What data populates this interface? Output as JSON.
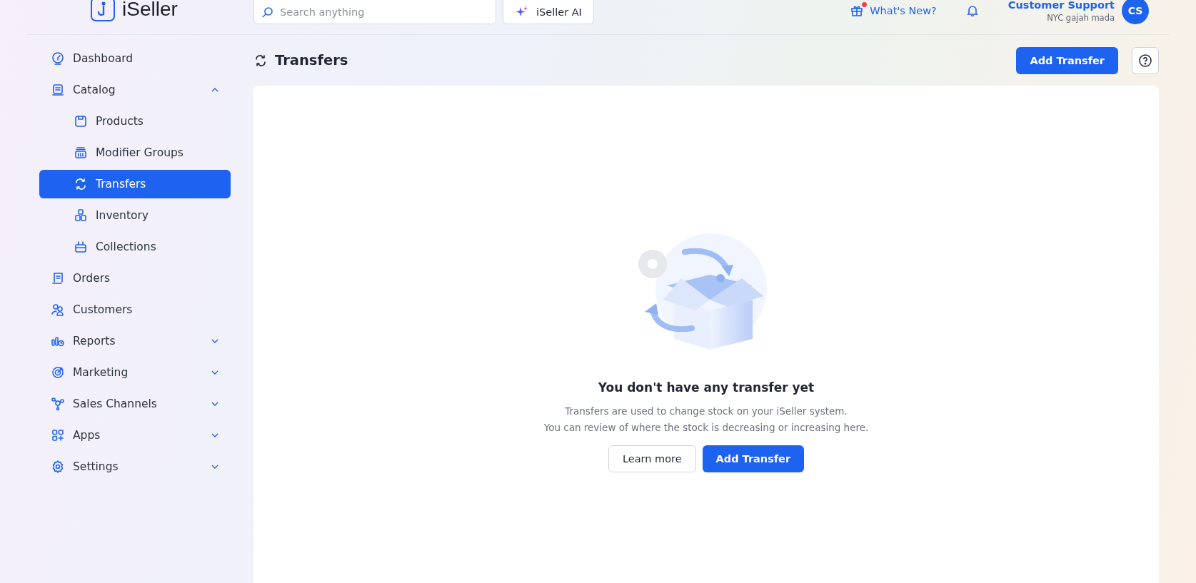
{
  "header": {
    "logo_text": "iSeller",
    "search": {
      "placeholder": "Search anything"
    },
    "ai_button": "iSeller AI",
    "whats_new": {
      "label": "What's New?",
      "has_notification": true
    },
    "user": {
      "name": "Customer Support",
      "store": "NYC gajah mada",
      "initials": "CS"
    }
  },
  "sidebar": {
    "items": [
      {
        "label": "Dashboard",
        "kind": "dashboard",
        "selected": false
      },
      {
        "label": "Catalog",
        "kind": "catalog",
        "selected": false,
        "expanded": true,
        "children": [
          {
            "label": "Products",
            "kind": "products",
            "selected": false
          },
          {
            "label": "Modifier Groups",
            "kind": "modifier",
            "selected": false
          },
          {
            "label": "Transfers",
            "kind": "transfers",
            "selected": true
          },
          {
            "label": "Inventory",
            "kind": "inventory",
            "selected": false
          },
          {
            "label": "Collections",
            "kind": "collections",
            "selected": false
          }
        ]
      },
      {
        "label": "Orders",
        "kind": "orders",
        "selected": false
      },
      {
        "label": "Customers",
        "kind": "customers",
        "selected": false
      },
      {
        "label": "Reports",
        "kind": "reports",
        "selected": false,
        "expanded": false
      },
      {
        "label": "Marketing",
        "kind": "marketing",
        "selected": false,
        "expanded": false
      },
      {
        "label": "Sales Channels",
        "kind": "channels",
        "selected": false,
        "expanded": false
      },
      {
        "label": "Apps",
        "kind": "apps",
        "selected": false,
        "expanded": false
      },
      {
        "label": "Settings",
        "kind": "settings",
        "selected": false,
        "expanded": false
      }
    ]
  },
  "page": {
    "title": "Transfers",
    "primary_button": "Add Transfer"
  },
  "empty_state": {
    "heading": "You don't have any transfer yet",
    "lines": [
      "Transfers are used to change stock on your iSeller system.",
      "You can review of where the stock is decreasing or increasing here."
    ],
    "secondary_button": "Learn more",
    "primary_button": "Add Transfer"
  }
}
